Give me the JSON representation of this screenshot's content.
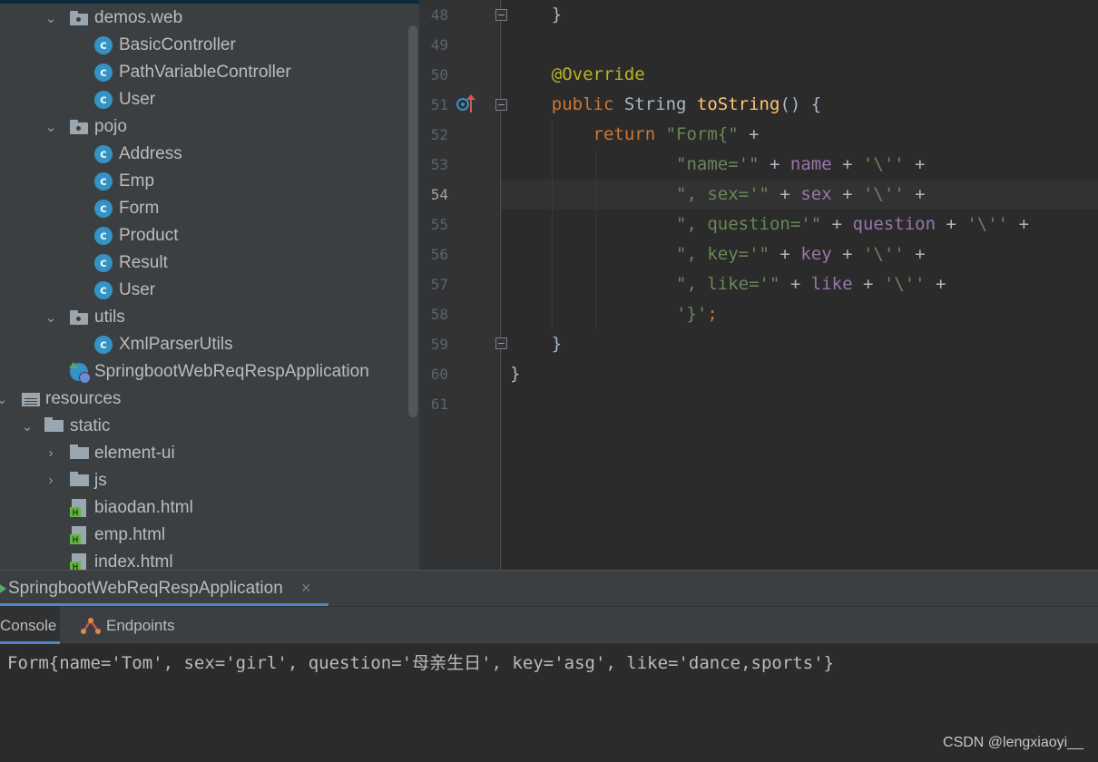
{
  "project_tree": {
    "items": [
      {
        "label": "demos.web",
        "type": "package",
        "expanded": true
      },
      {
        "label": "BasicController",
        "type": "class"
      },
      {
        "label": "PathVariableController",
        "type": "class"
      },
      {
        "label": "User",
        "type": "class"
      },
      {
        "label": "pojo",
        "type": "package",
        "expanded": true
      },
      {
        "label": "Address",
        "type": "class"
      },
      {
        "label": "Emp",
        "type": "class"
      },
      {
        "label": "Form",
        "type": "class"
      },
      {
        "label": "Product",
        "type": "class"
      },
      {
        "label": "Result",
        "type": "class"
      },
      {
        "label": "User",
        "type": "class"
      },
      {
        "label": "utils",
        "type": "package",
        "expanded": true
      },
      {
        "label": "XmlParserUtils",
        "type": "class"
      },
      {
        "label": "SpringbootWebReqRespApplication",
        "type": "spring-app"
      },
      {
        "label": "resources",
        "type": "resource-folder",
        "expanded": true
      },
      {
        "label": "static",
        "type": "folder",
        "expanded": true
      },
      {
        "label": "element-ui",
        "type": "folder",
        "expanded": false
      },
      {
        "label": "js",
        "type": "folder",
        "expanded": false
      },
      {
        "label": "biaodan.html",
        "type": "html-file"
      },
      {
        "label": "emp.html",
        "type": "html-file"
      },
      {
        "label": "index.html",
        "type": "html-file"
      }
    ]
  },
  "editor": {
    "current_line": "54",
    "line_numbers": [
      "48",
      "49",
      "50",
      "51",
      "52",
      "53",
      "54",
      "55",
      "56",
      "57",
      "58",
      "59",
      "60",
      "61"
    ]
  },
  "run_panel": {
    "run_tab_label": "SpringbootWebReqRespApplication",
    "close_glyph": "×",
    "console_tab": "Console",
    "endpoints_tab": "Endpoints",
    "output": "Form{name='Tom', sex='girl', question='母亲生日', key='asg', like='dance,sports'}"
  },
  "watermark": "CSDN @lengxiaoyi__",
  "colors": {
    "keyword": "#cc7832",
    "annotation": "#bbb529",
    "string": "#6a8759",
    "field": "#9876aa",
    "method": "#ffc66d",
    "accent": "#4a88c7"
  }
}
